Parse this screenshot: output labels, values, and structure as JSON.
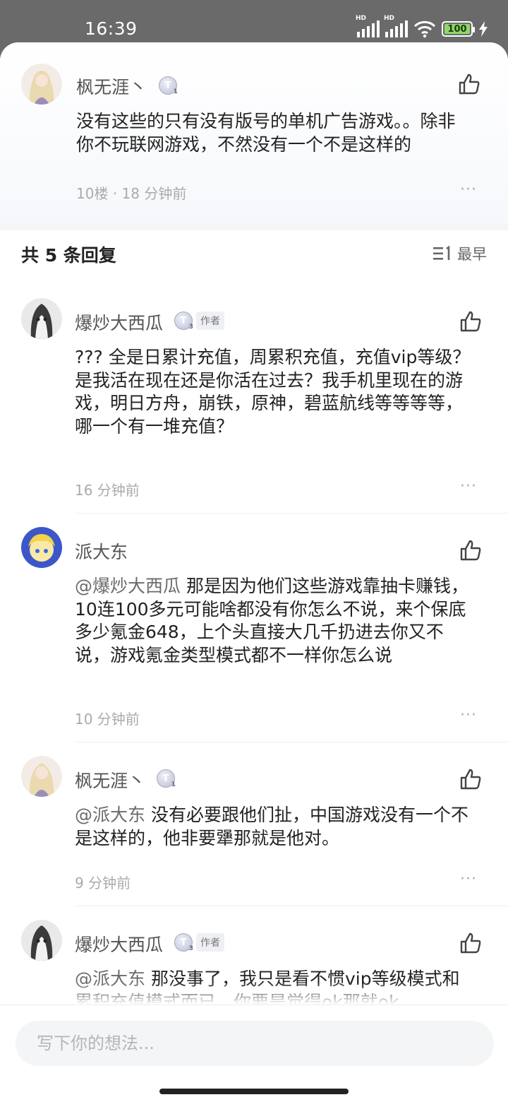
{
  "status_bar": {
    "time": "16:39",
    "battery": "100"
  },
  "main_comment": {
    "user": "枫无涯丶",
    "level": "T",
    "level_sub": "1",
    "text": "没有这些的只有没有版号的单机广告游戏。。除非\n你不玩联网游戏，不然没有一个不是这样的",
    "meta": "10楼 · 18 分钟前",
    "more": "···"
  },
  "replies_header": {
    "title": "共 5 条回复",
    "sort_label": "最早"
  },
  "replies": [
    {
      "user": "爆炒大西瓜",
      "level": "T",
      "level_sub": "3",
      "tag": "作者",
      "mention": "",
      "text": "??? 全是日累计充值，周累积充值，充值vip等级？\n是我活在现在还是你活在过去？我手机里现在的游\n戏，明日方舟，崩铁，原神，碧蓝航线等等等等，\n哪一个有一堆充值？",
      "time": "16 分钟前"
    },
    {
      "user": "派大东",
      "level": "",
      "level_sub": "",
      "tag": "",
      "mention": "@爆炒大西瓜",
      "text": " 那是因为他们这些游戏靠抽卡赚钱，\n10连100多元可能啥都没有你怎么不说，来个保底\n多少氪金648，上个头直接大几千扔进去你又不\n说，游戏氪金类型模式都不一样你怎么说",
      "time": "10 分钟前"
    },
    {
      "user": "枫无涯丶",
      "level": "T",
      "level_sub": "1",
      "tag": "",
      "mention": "@派大东",
      "text": " 没有必要跟他们扯，中国游戏没有一个不\n是这样的，他非要犟那就是他对。",
      "time": "9 分钟前"
    },
    {
      "user": "爆炒大西瓜",
      "level": "T",
      "level_sub": "3",
      "tag": "作者",
      "mention": "@派大东",
      "text": " 那没事了，我只是看不惯vip等级模式和\n累积充值模式而已，你要是觉得ok那就ok",
      "time": ""
    }
  ],
  "input": {
    "placeholder": "写下你的想法..."
  },
  "colors": {
    "mention": "#6b6b6b",
    "meta": "#aaaaaa",
    "bg_band": "#f4f5f7"
  }
}
